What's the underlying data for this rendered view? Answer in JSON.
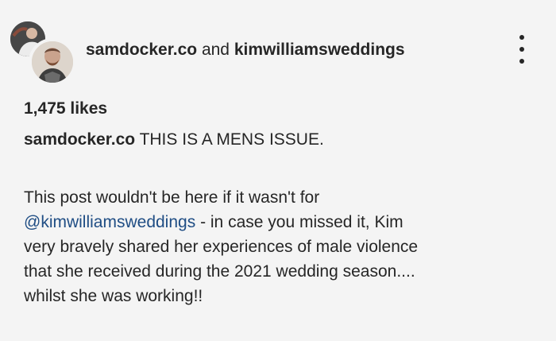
{
  "header": {
    "user_primary": "samdocker.co",
    "joiner": "and",
    "user_secondary": "kimwilliamsweddings",
    "more_icon": "more-vertical-icon"
  },
  "likes": "1,475 likes",
  "caption": {
    "username": "samdocker.co",
    "first_line": "THIS IS A MENS ISSUE.",
    "body": {
      "line1": "This post wouldn't be here if it wasn't for",
      "mention": "@kimwilliamsweddings",
      "line2_rest": "- in case you missed it, Kim",
      "line3": "very bravely shared her experiences of male violence",
      "line4": "that she received during the 2021 wedding season....",
      "line5": "whilst she was working!!"
    }
  },
  "colors": {
    "background": "#f4f4f4",
    "text": "#262626",
    "mention": "#1f4d84"
  }
}
